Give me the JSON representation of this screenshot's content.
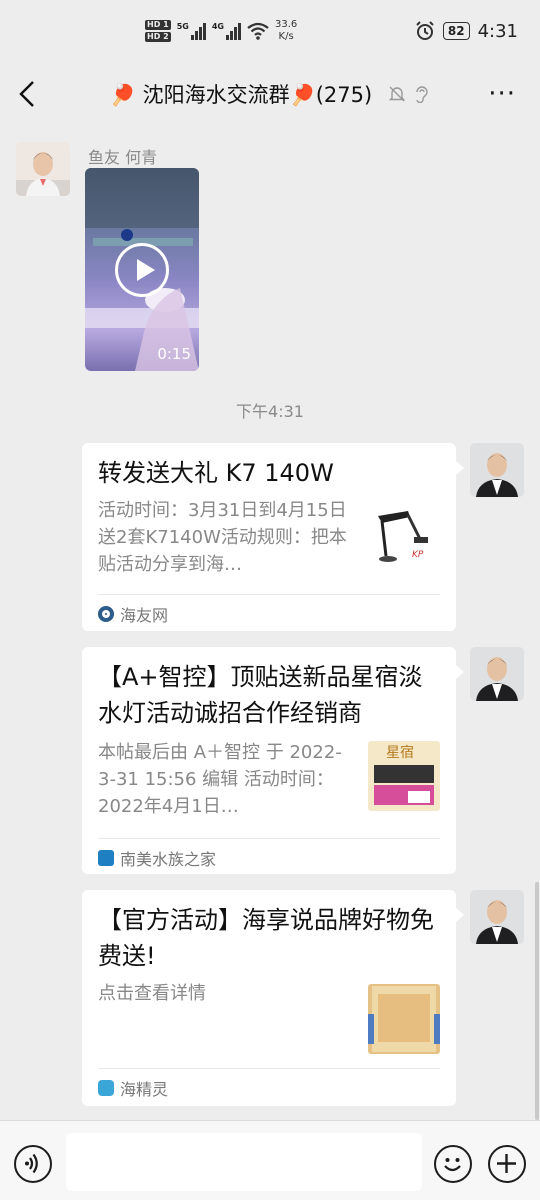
{
  "status_bar": {
    "net_badge_1": "HD 1",
    "net_badge_2": "HD 2",
    "sig1_label": "5G",
    "sig2_label": "4G",
    "speed_value": "33.6",
    "speed_unit": "K/s",
    "battery": "82",
    "time": "4:31"
  },
  "header": {
    "title": "🏓 沈阳海水交流群🏓(275)",
    "back_icon": "chevron-left-icon",
    "mute_icon": "bell-muted-icon",
    "extra_icon": "ear-icon",
    "more_label": "···"
  },
  "messages": [
    {
      "sender": "鱼友 何青",
      "type": "video",
      "duration": "0:15"
    }
  ],
  "timestamp": "下午4:31",
  "cards": [
    {
      "title": "转发送大礼 K7 140W",
      "desc": "活动时间：3月31日到4月15日送2套K7140W活动规则：把本贴活动分享到海…",
      "source": "海友网",
      "source_color": "#2d5d8a"
    },
    {
      "title": "【A+智控】顶贴送新品星宿淡水灯活动诚招合作经销商",
      "desc": "本帖最后由 A＋智控 于 2022-3-31 15:56 编辑 活动时间：2022年4月1日…",
      "source": "南美水族之家",
      "source_color": "#1e7fc2",
      "thumb_label": "星宿"
    },
    {
      "title": "【官方活动】海享说品牌好物免费送!",
      "desc": "点击查看详情",
      "source": "海精灵",
      "source_color": "#3aa6d8"
    }
  ],
  "input": {
    "voice_icon": "voice-icon",
    "emoji_icon": "emoji-icon",
    "add_icon": "plus-icon",
    "placeholder": ""
  }
}
